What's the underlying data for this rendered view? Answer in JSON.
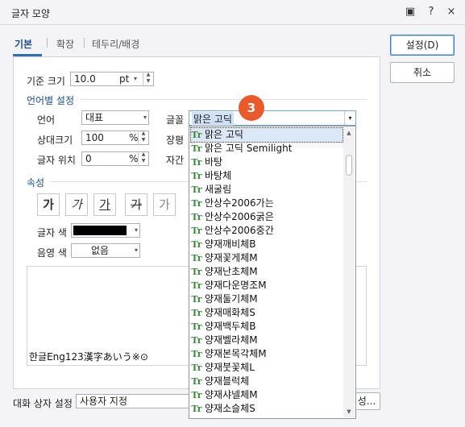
{
  "window": {
    "title": "글자 모양",
    "buttons": [
      "▣",
      "?",
      "×"
    ]
  },
  "tabs": [
    "기본",
    "확장",
    "테두리/배경"
  ],
  "base_size": {
    "label": "기준 크기",
    "value": "10.0",
    "unit": "pt"
  },
  "lang_section": "언어별 설정",
  "language": {
    "label": "언어",
    "value": "대표"
  },
  "relative_size": {
    "label": "상대크기",
    "value": "100",
    "unit": "%"
  },
  "char_position": {
    "label": "글자 위치",
    "value": "0",
    "unit": "%"
  },
  "font_label": "글꼴",
  "jangpyeong_label": "장평",
  "jagan_label": "자간",
  "font_value": "맑은 고딕",
  "attr_section": "속성",
  "format_buttons": [
    "가",
    "가",
    "가",
    "가",
    "가",
    "가"
  ],
  "text_color_label": "글자 색",
  "shade_color_label": "음영 색",
  "shade_value": "없음",
  "preview_text": "한글Eng123漢字あいう※⊙",
  "dialog_setting": {
    "label": "대화 상자 설정",
    "value": "사용자 지정",
    "right_btn": "성..."
  },
  "buttons": {
    "ok": "설정(D)",
    "cancel": "취소"
  },
  "badge": "3",
  "font_list": [
    "맑은 고딕",
    "맑은 고딕 Semilight",
    "바탕",
    "바탕체",
    "새굴림",
    "안상수2006가는",
    "안상수2006굵은",
    "안상수2006중간",
    "양재깨비체B",
    "양재꽃게체M",
    "양재난초체M",
    "양재다운명조M",
    "양재둘기체M",
    "양재매화체S",
    "양재백두체B",
    "양재벨라체M",
    "양재본목각체M",
    "양재붓꽃체L",
    "양재블럭체",
    "양재샤넬체M",
    "양재소슬체S"
  ],
  "icon_glyph": "Tr",
  "colors": {
    "accent": "#1a4e8c",
    "badge": "#e85a2b",
    "text_color": "#000000"
  }
}
